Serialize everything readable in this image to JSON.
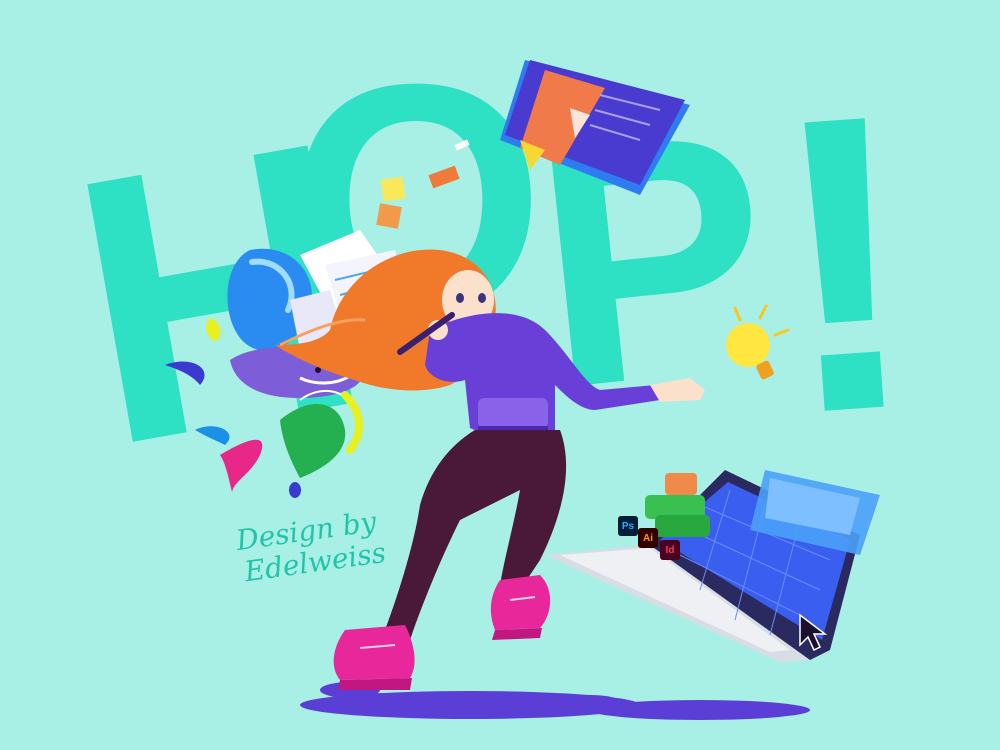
{
  "poster": {
    "headline_letters": [
      "H",
      "O",
      "P",
      "!"
    ],
    "credit_line1": "Design by",
    "credit_line2": "Edelweiss"
  },
  "app_badges": [
    {
      "label": "Ps",
      "color": "#31a8ff",
      "bg": "#001e36"
    },
    {
      "label": "Ai",
      "color": "#ff9a00",
      "bg": "#330000"
    },
    {
      "label": "Id",
      "color": "#ff3366",
      "bg": "#49021f"
    }
  ],
  "colors": {
    "background": "#a8f0e6",
    "headline": "#2ee0c4",
    "hoodie": "#6a3fd8",
    "hair": "#f07a2a",
    "leggings": "#4a1838",
    "boots": "#e8289a",
    "laptop_screen": "#3a5ff0"
  },
  "icons": [
    "lightbulb-icon",
    "cursor-icon",
    "whale-icon",
    "sticky-note-icon",
    "chat-bubble-icon"
  ]
}
